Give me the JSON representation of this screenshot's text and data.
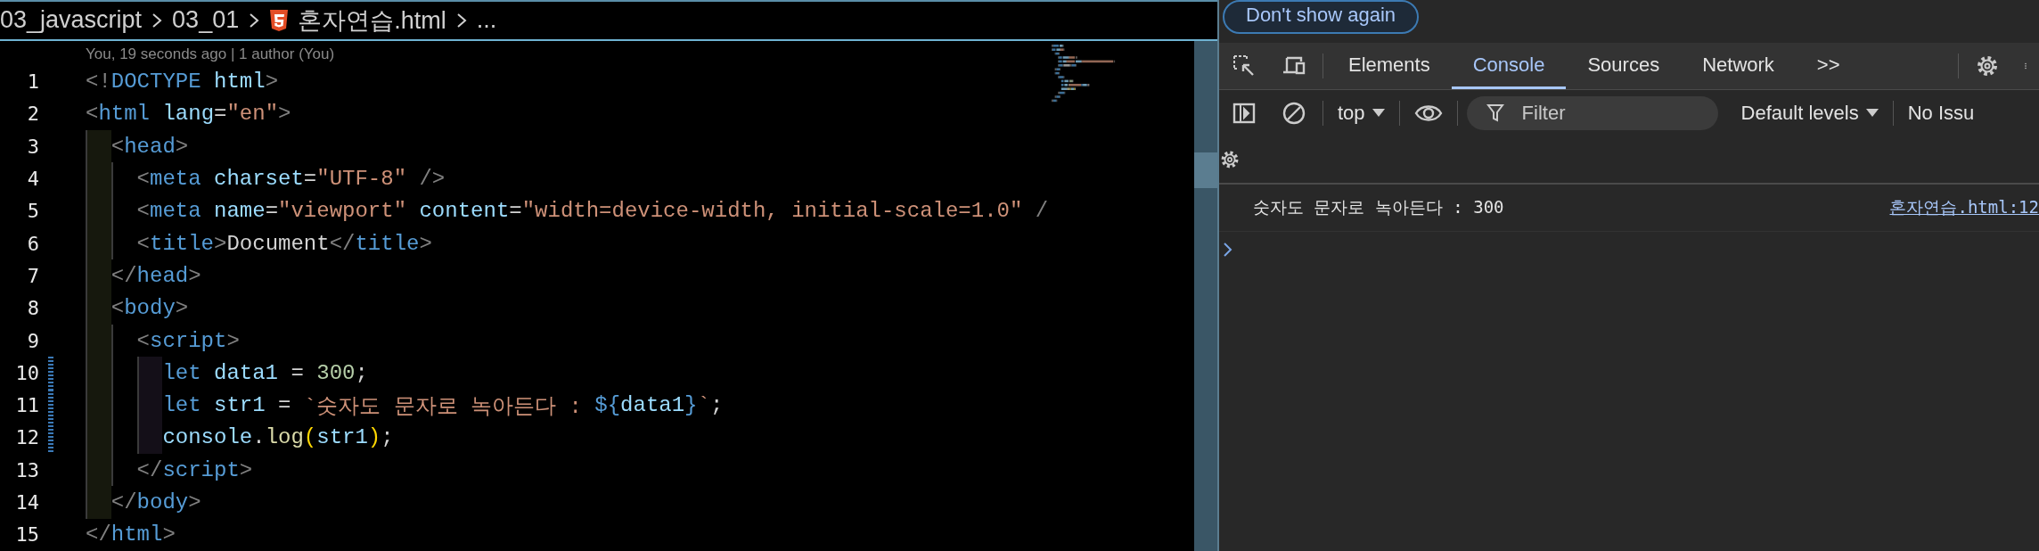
{
  "editor": {
    "breadcrumb": [
      {
        "kind": "folder",
        "label": "03_javascript"
      },
      {
        "kind": "folder",
        "label": "03_01"
      },
      {
        "kind": "html-file",
        "label": "혼자연습.html"
      },
      {
        "kind": "more",
        "label": "..."
      }
    ],
    "blame": "You, 19 seconds ago | 1 author (You)",
    "lines": [
      {
        "number": "1",
        "modified": false,
        "tokens": [
          {
            "kind": "punct",
            "text": "<!"
          },
          {
            "kind": "tag",
            "text": "DOCTYPE"
          },
          {
            "kind": "attr",
            "text": " html"
          },
          {
            "kind": "punct",
            "text": ">"
          }
        ]
      },
      {
        "number": "2",
        "modified": false,
        "tokens": [
          {
            "kind": "punct",
            "text": "<"
          },
          {
            "kind": "tag",
            "text": "html"
          },
          {
            "kind": "attr",
            "text": " lang"
          },
          {
            "kind": "plain",
            "text": "="
          },
          {
            "kind": "string",
            "text": "\"en\""
          },
          {
            "kind": "punct",
            "text": ">"
          }
        ]
      },
      {
        "number": "3",
        "modified": false,
        "tokens": [
          {
            "kind": "punct",
            "text": "  <"
          },
          {
            "kind": "tag",
            "text": "head"
          },
          {
            "kind": "punct",
            "text": ">"
          }
        ]
      },
      {
        "number": "4",
        "modified": false,
        "tokens": [
          {
            "kind": "punct",
            "text": "    <"
          },
          {
            "kind": "tag",
            "text": "meta"
          },
          {
            "kind": "attr",
            "text": " charset"
          },
          {
            "kind": "plain",
            "text": "="
          },
          {
            "kind": "string",
            "text": "\"UTF-8\""
          },
          {
            "kind": "punct",
            "text": " />"
          }
        ]
      },
      {
        "number": "5",
        "modified": false,
        "tokens": [
          {
            "kind": "punct",
            "text": "    <"
          },
          {
            "kind": "tag",
            "text": "meta"
          },
          {
            "kind": "attr",
            "text": " name"
          },
          {
            "kind": "plain",
            "text": "="
          },
          {
            "kind": "string",
            "text": "\"viewport\""
          },
          {
            "kind": "attr",
            "text": " content"
          },
          {
            "kind": "plain",
            "text": "="
          },
          {
            "kind": "string",
            "text": "\"width=device-width, initial-scale=1.0\""
          },
          {
            "kind": "punct",
            "text": " /"
          }
        ]
      },
      {
        "number": "6",
        "modified": false,
        "tokens": [
          {
            "kind": "punct",
            "text": "    <"
          },
          {
            "kind": "tag",
            "text": "title"
          },
          {
            "kind": "punct",
            "text": ">"
          },
          {
            "kind": "plain",
            "text": "Document"
          },
          {
            "kind": "punct",
            "text": "</"
          },
          {
            "kind": "tag",
            "text": "title"
          },
          {
            "kind": "punct",
            "text": ">"
          }
        ]
      },
      {
        "number": "7",
        "modified": false,
        "tokens": [
          {
            "kind": "punct",
            "text": "  </"
          },
          {
            "kind": "tag",
            "text": "head"
          },
          {
            "kind": "punct",
            "text": ">"
          }
        ]
      },
      {
        "number": "8",
        "modified": false,
        "tokens": [
          {
            "kind": "punct",
            "text": "  <"
          },
          {
            "kind": "tag",
            "text": "body"
          },
          {
            "kind": "punct",
            "text": ">"
          }
        ]
      },
      {
        "number": "9",
        "modified": false,
        "tokens": [
          {
            "kind": "punct",
            "text": "    <"
          },
          {
            "kind": "tag",
            "text": "script"
          },
          {
            "kind": "punct",
            "text": ">"
          }
        ]
      },
      {
        "number": "10",
        "modified": true,
        "tokens": [
          {
            "kind": "keyword",
            "text": "      let"
          },
          {
            "kind": "var",
            "text": " data1"
          },
          {
            "kind": "plain",
            "text": " = "
          },
          {
            "kind": "number",
            "text": "300"
          },
          {
            "kind": "plain",
            "text": ";"
          }
        ]
      },
      {
        "number": "11",
        "modified": true,
        "tokens": [
          {
            "kind": "keyword",
            "text": "      let"
          },
          {
            "kind": "var",
            "text": " str1"
          },
          {
            "kind": "plain",
            "text": " = "
          },
          {
            "kind": "string",
            "text": "`숫자도 문자로 녹아든다 : "
          },
          {
            "kind": "keyword",
            "text": "${"
          },
          {
            "kind": "var",
            "text": "data1"
          },
          {
            "kind": "keyword",
            "text": "}"
          },
          {
            "kind": "string",
            "text": "`"
          },
          {
            "kind": "plain",
            "text": ";"
          }
        ]
      },
      {
        "number": "12",
        "modified": true,
        "tokens": [
          {
            "kind": "var",
            "text": "      console"
          },
          {
            "kind": "plain",
            "text": "."
          },
          {
            "kind": "func",
            "text": "log"
          },
          {
            "kind": "bracket",
            "text": "("
          },
          {
            "kind": "var",
            "text": "str1"
          },
          {
            "kind": "bracket",
            "text": ")"
          },
          {
            "kind": "plain",
            "text": ";"
          }
        ]
      },
      {
        "number": "13",
        "modified": false,
        "tokens": [
          {
            "kind": "punct",
            "text": "    </"
          },
          {
            "kind": "tag",
            "text": "script"
          },
          {
            "kind": "punct",
            "text": ">"
          }
        ]
      },
      {
        "number": "14",
        "modified": false,
        "tokens": [
          {
            "kind": "punct",
            "text": "  </"
          },
          {
            "kind": "tag",
            "text": "body"
          },
          {
            "kind": "punct",
            "text": ">"
          }
        ]
      },
      {
        "number": "15",
        "modified": false,
        "tokens": [
          {
            "kind": "punct",
            "text": "</"
          },
          {
            "kind": "tag",
            "text": "html"
          },
          {
            "kind": "punct",
            "text": ">"
          }
        ]
      }
    ]
  },
  "devtools": {
    "banner_button": "Don't show again",
    "tabs": [
      {
        "label": "Elements",
        "selected": false
      },
      {
        "label": "Console",
        "selected": true
      },
      {
        "label": "Sources",
        "selected": false
      },
      {
        "label": "Network",
        "selected": false
      }
    ],
    "more_tabs": ">>",
    "context": "top",
    "filter": {
      "placeholder": "Filter"
    },
    "levels": "Default levels",
    "issues": "No Issu",
    "messages": [
      {
        "text": "숫자도 문자로 녹아든다 : 300",
        "source": "혼자연습.html:12"
      }
    ]
  }
}
